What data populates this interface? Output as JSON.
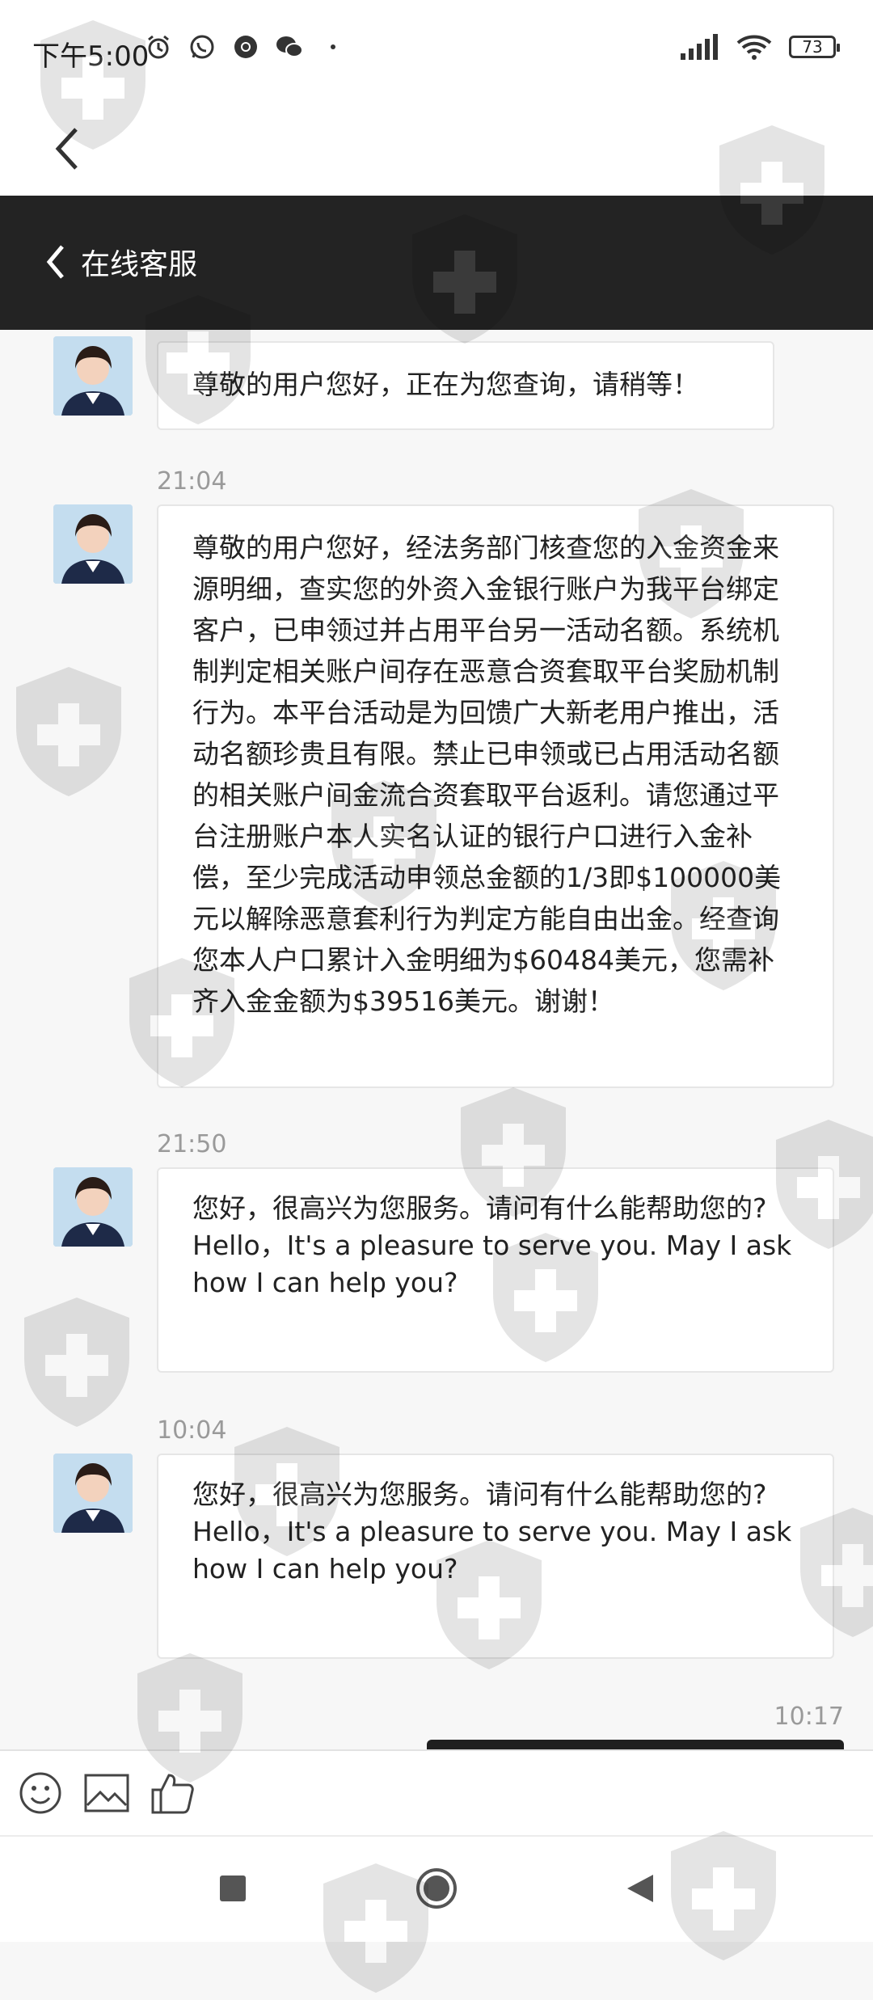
{
  "status_bar": {
    "time": "下午5:00",
    "battery": "73",
    "icons_left": [
      "alarm-icon",
      "whatsapp-icon",
      "chrome-icon",
      "wechat-icon",
      "dot-icon"
    ],
    "icons_right": [
      "signal-icon",
      "wifi-icon",
      "battery-icon"
    ]
  },
  "header": {
    "title": "在线客服"
  },
  "messages": [
    {
      "text": "尊敬的用户您好，正在为您查询，请稍等！"
    },
    {
      "timestamp": "21:04",
      "text": "尊敬的用户您好，经法务部门核查您的入金资金来源明细，查实您的外资入金银行账户为我平台绑定客户，已申领过并占用平台另一活动名额。系统机制判定相关账户间存在恶意合资套取平台奖励机制行为。本平台活动是为回馈广大新老用户推出，活动名额珍贵且有限。禁止已申领或已占用活动名额的相关账户间金流合资套取平台返利。请您通过平台注册账户本人实名认证的银行户口进行入金补偿，至少完成活动申领总金额的1/3即$100000美元以解除恶意套利行为判定方能自由出金。经查询您本人户口累计入金明细为$60484美元，您需补齐入金金额为$39516美元。谢谢！"
    },
    {
      "timestamp": "21:50",
      "text": "您好，很高兴为您服务。请问有什么能帮助您的?\nHello，It's a pleasure to serve you. May I ask how I can help you?"
    },
    {
      "timestamp": "10:04",
      "text": "您好，很高兴为您服务。请问有什么能帮助您的?\nHello，It's a pleasure to serve you. May I ask how I can help you?"
    }
  ],
  "last_timestamp": "10:17",
  "toolbar": {
    "icons": [
      "emoji-icon",
      "image-icon",
      "thumbs-up-icon"
    ]
  },
  "nav_bar": {
    "icons": [
      "recent-apps-icon",
      "home-icon",
      "back-icon"
    ]
  },
  "colors": {
    "header_bg": "#232323",
    "page_bg": "#f7f7f7",
    "bubble_bg": "#ffffff"
  }
}
